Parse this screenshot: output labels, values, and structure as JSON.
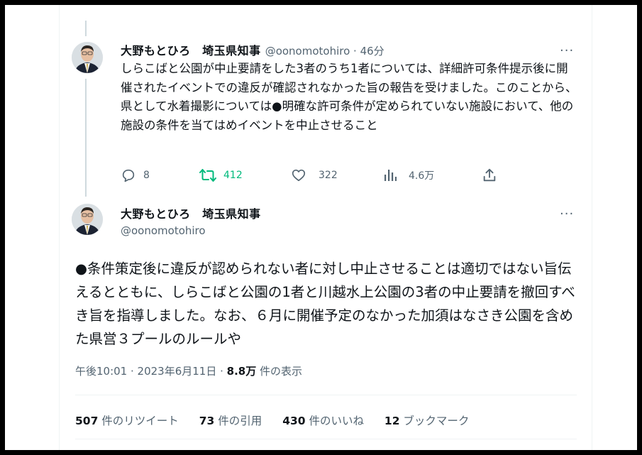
{
  "tweet_parent": {
    "display_name": "大野もとひろ　埼玉県知事",
    "handle_time": "@oonomotohiro · 46分",
    "text": "しらこばと公園が中止要請をした3者のうち1者については、詳細許可条件提示後に開催されたイベントでの違反が確認されなかった旨の報告を受けました。このことから、県として水着撮影については●明確な許可条件が定められていない施設において、他の施設の条件を当てはめイベントを中止させること",
    "replies": "8",
    "retweets": "412",
    "likes": "322",
    "views": "4.6万"
  },
  "tweet_main": {
    "display_name": "大野もとひろ　埼玉県知事",
    "handle": "@oonomotohiro",
    "text": "●条件策定後に違反が認められない者に対し中止させることは適切ではない旨伝えるとともに、しらこばと公園の1者と川越水上公園の3者の中止要請を撤回すべき旨を指導しました。なお、６月に開催予定のなかった加須はなさき公園を含めた県営３プールのルールや",
    "timestamp": "午後10:01 · 2023年6月11日 · ",
    "views_count": "8.8万",
    "views_label": " 件の表示",
    "stats": {
      "retweets_count": "507",
      "retweets_label": " 件のリツイート",
      "quotes_count": "73",
      "quotes_label": " 件の引用",
      "likes_count": "430",
      "likes_label": " 件のいいね",
      "bookmarks_count": "12",
      "bookmarks_label": " ブックマーク"
    }
  },
  "more_glyph": "···",
  "colors": {
    "text": "#0f1419",
    "muted": "#536471",
    "retweet_green": "#00ba7c",
    "thread_line": "#cfd9de"
  }
}
